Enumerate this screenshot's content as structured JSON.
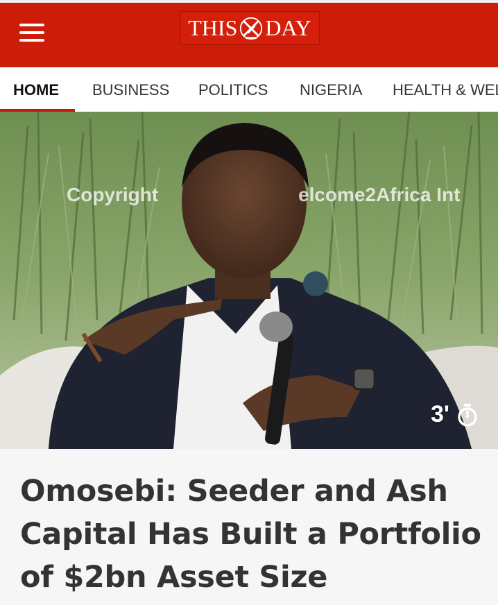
{
  "header": {
    "logo": {
      "text_left": "THIS",
      "text_right": "DAY",
      "colors": {
        "bar": "#cc1d08",
        "logo_bg": "#d41f0b"
      }
    }
  },
  "nav": {
    "items": [
      {
        "label": "HOME",
        "active": true
      },
      {
        "label": "BUSINESS",
        "active": false
      },
      {
        "label": "POLITICS",
        "active": false
      },
      {
        "label": "NIGERIA",
        "active": false
      },
      {
        "label": "HEALTH & WEL",
        "active": false
      }
    ],
    "accent": "#c41a06"
  },
  "hero": {
    "watermark_left": "Copyright",
    "watermark_right": "elcome2Africa Int",
    "read_time": "3'",
    "read_time_icon": "stopwatch-icon"
  },
  "article": {
    "headline": "Omosebi: Seeder and Ash Capital Has Built a Portfolio of $2bn Asset Size"
  }
}
